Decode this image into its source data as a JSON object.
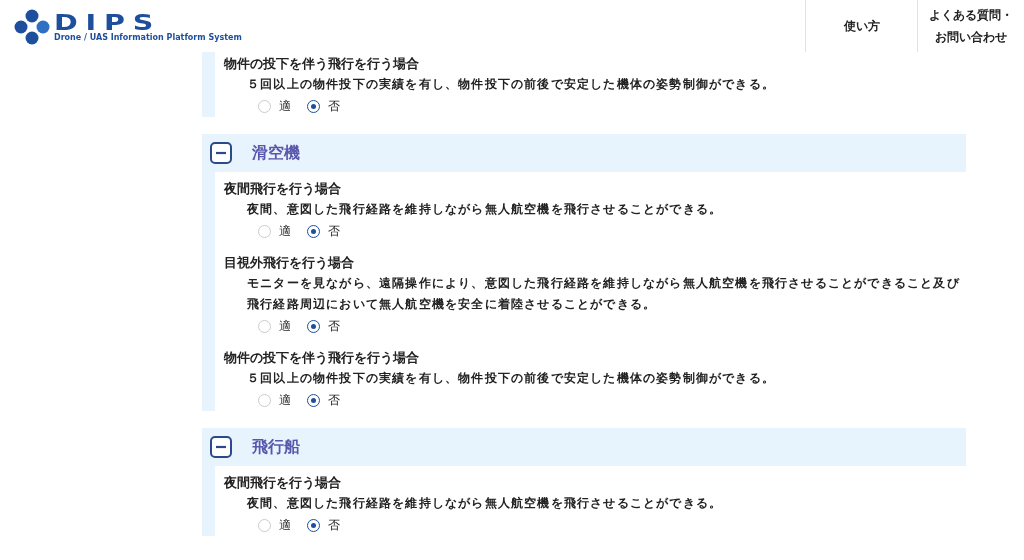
{
  "header": {
    "logo": {
      "title": "DIPS",
      "subtitle": "Drone / UAS Information Platform System"
    },
    "nav": [
      {
        "lines": [
          "使い方"
        ]
      },
      {
        "lines": [
          "よくある質問・",
          "お問い合わせ"
        ]
      }
    ]
  },
  "sections": [
    {
      "items": [
        {
          "title": "物件の投下を伴う飛行を行う場合",
          "description": "５回以上の物件投下の実績を有し、物件投下の前後で安定した機体の姿勢制御ができる。",
          "options": [
            {
              "label": "適",
              "selected": false
            },
            {
              "label": "否",
              "selected": true
            }
          ]
        }
      ]
    },
    {
      "title": "滑空機",
      "expanded": true,
      "items": [
        {
          "title": "夜間飛行を行う場合",
          "description": "夜間、意図した飛行経路を維持しながら無人航空機を飛行させることができる。",
          "options": [
            {
              "label": "適",
              "selected": false
            },
            {
              "label": "否",
              "selected": true
            }
          ]
        },
        {
          "title": "目視外飛行を行う場合",
          "description": "モニターを見ながら、遠隔操作により、意図した飛行経路を維持しながら無人航空機を飛行させることができること及び飛行経路周辺において無人航空機を安全に着陸させることができる。",
          "options": [
            {
              "label": "適",
              "selected": false
            },
            {
              "label": "否",
              "selected": true
            }
          ]
        },
        {
          "title": "物件の投下を伴う飛行を行う場合",
          "description": "５回以上の物件投下の実績を有し、物件投下の前後で安定した機体の姿勢制御ができる。",
          "options": [
            {
              "label": "適",
              "selected": false
            },
            {
              "label": "否",
              "selected": true
            }
          ]
        }
      ]
    },
    {
      "title": "飛行船",
      "expanded": true,
      "items": [
        {
          "title": "夜間飛行を行う場合",
          "description": "夜間、意図した飛行経路を維持しながら無人航空機を飛行させることができる。",
          "options": [
            {
              "label": "適",
              "selected": false
            },
            {
              "label": "否",
              "selected": true
            }
          ]
        }
      ]
    }
  ]
}
